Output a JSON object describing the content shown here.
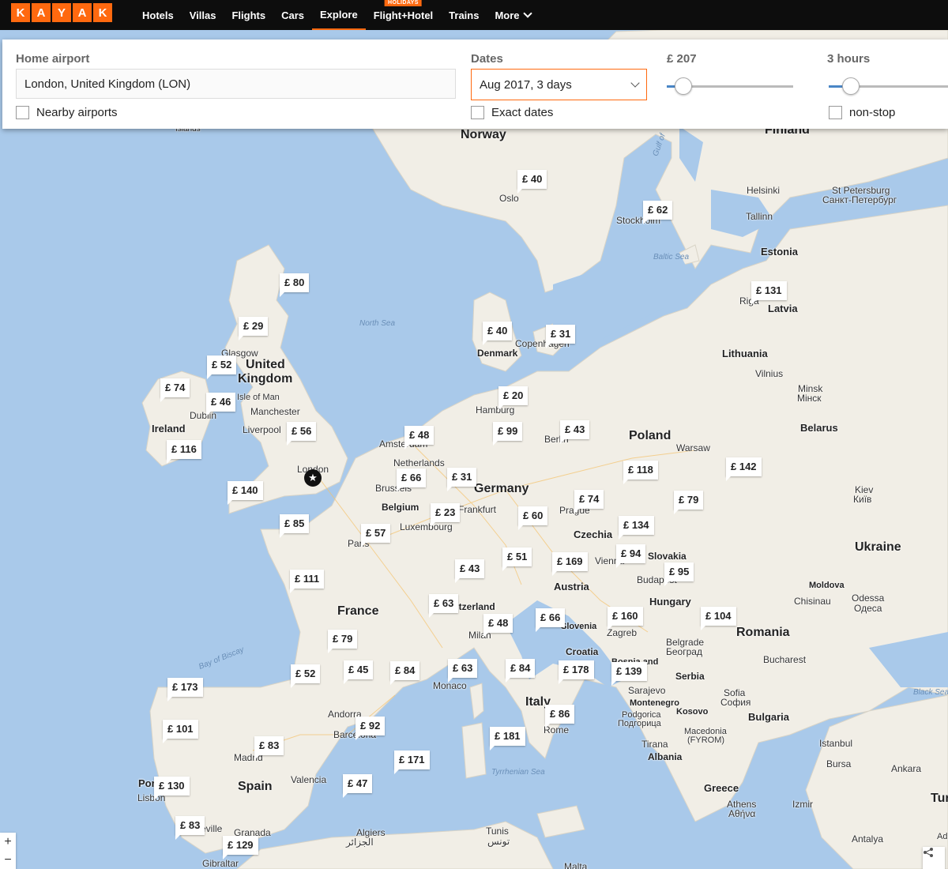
{
  "logo": [
    "K",
    "A",
    "Y",
    "A",
    "K"
  ],
  "nav": {
    "items": [
      {
        "label": "Hotels",
        "active": false
      },
      {
        "label": "Villas",
        "active": false
      },
      {
        "label": "Flights",
        "active": false
      },
      {
        "label": "Cars",
        "active": false
      },
      {
        "label": "Explore",
        "active": true
      },
      {
        "label": "Flight+Hotel",
        "active": false,
        "badge": "HOLIDAYS"
      },
      {
        "label": "Trains",
        "active": false
      },
      {
        "label": "More",
        "active": false,
        "icon": "chevron-down-icon"
      }
    ]
  },
  "filters": {
    "home_airport": {
      "label": "Home airport",
      "value": "London, United Kingdom (LON)"
    },
    "nearby": {
      "label": "Nearby airports",
      "checked": false
    },
    "dates": {
      "label": "Dates",
      "value": "Aug 2017, 3 days"
    },
    "exact": {
      "label": "Exact dates",
      "checked": false
    },
    "price": {
      "label": "£ 207"
    },
    "duration": {
      "label": "3 hours"
    },
    "nonstop": {
      "label": "non-stop",
      "checked": false
    }
  },
  "map": {
    "places": [
      {
        "name": "Norway",
        "kind": "country"
      },
      {
        "name": "Finland",
        "kind": "country"
      },
      {
        "name": "United",
        "kind": "country"
      },
      {
        "name": "Kingdom",
        "kind": "country"
      },
      {
        "name": "Ireland",
        "kind": "country-s"
      },
      {
        "name": "Estonia",
        "kind": "country-s"
      },
      {
        "name": "Latvia",
        "kind": "country-s"
      },
      {
        "name": "Lithuania",
        "kind": "country-s"
      },
      {
        "name": "Belarus",
        "kind": "country-s"
      },
      {
        "name": "Poland",
        "kind": "country"
      },
      {
        "name": "Germany",
        "kind": "country"
      },
      {
        "name": "Ukraine",
        "kind": "country"
      },
      {
        "name": "France",
        "kind": "country"
      },
      {
        "name": "Romania",
        "kind": "country"
      },
      {
        "name": "Spain",
        "kind": "country"
      },
      {
        "name": "Italy",
        "kind": "country"
      },
      {
        "name": "Greece",
        "kind": "country-s"
      },
      {
        "name": "Czechia",
        "kind": "country-s"
      },
      {
        "name": "Austria",
        "kind": "country-s"
      },
      {
        "name": "Hungary",
        "kind": "country-s"
      },
      {
        "name": "Denmark",
        "kind": "country-s"
      },
      {
        "name": "Belgium",
        "kind": "country-s"
      },
      {
        "name": "Serbia",
        "kind": "country-s"
      },
      {
        "name": "Bulgaria",
        "kind": "country-s"
      },
      {
        "name": "Croatia",
        "kind": "country-s"
      },
      {
        "name": "Albania",
        "kind": "country-s"
      },
      {
        "name": "Moldova",
        "kind": "country-s"
      },
      {
        "name": "Kosovo",
        "kind": "country-s"
      },
      {
        "name": "Montenegro",
        "kind": "country-s"
      },
      {
        "name": "North Sea",
        "kind": "sea"
      },
      {
        "name": "Baltic Sea",
        "kind": "sea"
      },
      {
        "name": "Bay of Biscay",
        "kind": "sea"
      },
      {
        "name": "Tyrrhenian Sea",
        "kind": "sea"
      },
      {
        "name": "Black Sea",
        "kind": "sea"
      },
      {
        "name": "Oslo",
        "kind": "city"
      },
      {
        "name": "Helsinki",
        "kind": "city"
      },
      {
        "name": "St Petersburg",
        "kind": "city"
      },
      {
        "name": "Санкт-Петербург",
        "kind": "city"
      },
      {
        "name": "Tallinn",
        "kind": "city"
      },
      {
        "name": "Glasgow",
        "kind": "city"
      },
      {
        "name": "Manchester",
        "kind": "city"
      },
      {
        "name": "Liverpool",
        "kind": "city"
      },
      {
        "name": "Dublin",
        "kind": "city"
      },
      {
        "name": "London",
        "kind": "city"
      },
      {
        "name": "Hamburg",
        "kind": "city"
      },
      {
        "name": "Amsterdam",
        "kind": "city"
      },
      {
        "name": "Netherlands",
        "kind": "country-s"
      },
      {
        "name": "Brussels",
        "kind": "city"
      },
      {
        "name": "Luxembourg",
        "kind": "city"
      },
      {
        "name": "Paris",
        "kind": "city"
      },
      {
        "name": "Warsaw",
        "kind": "city"
      },
      {
        "name": "Kiev",
        "kind": "city"
      },
      {
        "name": "Київ",
        "kind": "city"
      },
      {
        "name": "Minsk",
        "kind": "city"
      },
      {
        "name": "Мінск",
        "kind": "city"
      },
      {
        "name": "Vilnius",
        "kind": "city"
      },
      {
        "name": "Riga",
        "kind": "city"
      },
      {
        "name": "Prague",
        "kind": "city"
      },
      {
        "name": "Vienna",
        "kind": "city"
      },
      {
        "name": "Budapest",
        "kind": "city"
      },
      {
        "name": "Zagreb",
        "kind": "city"
      },
      {
        "name": "Belgrade",
        "kind": "city"
      },
      {
        "name": "Београд",
        "kind": "city"
      },
      {
        "name": "Bucharest",
        "kind": "city"
      },
      {
        "name": "Chisinau",
        "kind": "city"
      },
      {
        "name": "Odessa",
        "kind": "city"
      },
      {
        "name": "Одеса",
        "kind": "city"
      },
      {
        "name": "Sofia",
        "kind": "city"
      },
      {
        "name": "София",
        "kind": "city"
      },
      {
        "name": "Istanbul",
        "kind": "city"
      },
      {
        "name": "Bursa",
        "kind": "city"
      },
      {
        "name": "Ankara",
        "kind": "city"
      },
      {
        "name": "Izmir",
        "kind": "city"
      },
      {
        "name": "Athens",
        "kind": "city"
      },
      {
        "name": "Αθήνα",
        "kind": "city"
      },
      {
        "name": "Antalya",
        "kind": "city"
      },
      {
        "name": "Macedonia",
        "kind": "city"
      },
      {
        "name": "(FYROM)",
        "kind": "city"
      },
      {
        "name": "Tirana",
        "kind": "city"
      },
      {
        "name": "Sarajevo",
        "kind": "city"
      },
      {
        "name": "Podgorica",
        "kind": "city"
      },
      {
        "name": "Подгорица",
        "kind": "city"
      },
      {
        "name": "Rome",
        "kind": "city"
      },
      {
        "name": "Monaco",
        "kind": "city"
      },
      {
        "name": "Andorra",
        "kind": "city"
      },
      {
        "name": "Barcelona",
        "kind": "city"
      },
      {
        "name": "Madrid",
        "kind": "city"
      },
      {
        "name": "Valencia",
        "kind": "city"
      },
      {
        "name": "Lisbon",
        "kind": "city"
      },
      {
        "name": "Seville",
        "kind": "city"
      },
      {
        "name": "Granada",
        "kind": "city"
      },
      {
        "name": "Gibraltar",
        "kind": "city"
      },
      {
        "name": "Algiers",
        "kind": "city"
      },
      {
        "name": "الجزائر",
        "kind": "city"
      },
      {
        "name": "Tunis",
        "kind": "city"
      },
      {
        "name": "تونس",
        "kind": "city"
      },
      {
        "name": "Malta",
        "kind": "city"
      },
      {
        "name": "Copenhagen",
        "kind": "city"
      },
      {
        "name": "Stockholm",
        "kind": "city"
      },
      {
        "name": "Berlin",
        "kind": "city"
      },
      {
        "name": "Frankfurt",
        "kind": "city"
      },
      {
        "name": "Milan",
        "kind": "city"
      },
      {
        "name": "Switzerland",
        "kind": "country-s"
      },
      {
        "name": "Slovakia",
        "kind": "country-s"
      },
      {
        "name": "Slovenia",
        "kind": "country-s"
      },
      {
        "name": "Isle of Man",
        "kind": "city"
      },
      {
        "name": "Islands",
        "kind": "city"
      },
      {
        "name": "Gulf of",
        "kind": "sea"
      },
      {
        "name": "Portugal",
        "kind": "country-s"
      },
      {
        "name": "Bosnia and",
        "kind": "country-s"
      },
      {
        "name": "Turkey",
        "kind": "country"
      },
      {
        "name": "Adana",
        "kind": "city"
      }
    ],
    "prices": [
      {
        "label": "£ 40"
      },
      {
        "label": "£ 62"
      },
      {
        "label": "£ 80"
      },
      {
        "label": "£ 29"
      },
      {
        "label": "£ 131"
      },
      {
        "label": "£ 52"
      },
      {
        "label": "£ 74"
      },
      {
        "label": "£ 46"
      },
      {
        "label": "£ 40"
      },
      {
        "label": "£ 31"
      },
      {
        "label": "£ 20"
      },
      {
        "label": "£ 116"
      },
      {
        "label": "£ 56"
      },
      {
        "label": "£ 48"
      },
      {
        "label": "£ 99"
      },
      {
        "label": "£ 43"
      },
      {
        "label": "£ 140"
      },
      {
        "label": "£ 66"
      },
      {
        "label": "£ 31"
      },
      {
        "label": "£ 118"
      },
      {
        "label": "£ 142"
      },
      {
        "label": "£ 74"
      },
      {
        "label": "£ 79"
      },
      {
        "label": "£ 23"
      },
      {
        "label": "£ 85"
      },
      {
        "label": "£ 60"
      },
      {
        "label": "£ 134"
      },
      {
        "label": "£ 57"
      },
      {
        "label": "£ 94"
      },
      {
        "label": "£ 51"
      },
      {
        "label": "£ 169"
      },
      {
        "label": "£ 95"
      },
      {
        "label": "£ 111"
      },
      {
        "label": "£ 43"
      },
      {
        "label": "£ 63"
      },
      {
        "label": "£ 66"
      },
      {
        "label": "£ 160"
      },
      {
        "label": "£ 104"
      },
      {
        "label": "£ 48"
      },
      {
        "label": "£ 79"
      },
      {
        "label": "£ 52"
      },
      {
        "label": "£ 45"
      },
      {
        "label": "£ 84"
      },
      {
        "label": "£ 63"
      },
      {
        "label": "£ 84"
      },
      {
        "label": "£ 178"
      },
      {
        "label": "£ 139"
      },
      {
        "label": "£ 173"
      },
      {
        "label": "£ 86"
      },
      {
        "label": "£ 92"
      },
      {
        "label": "£ 101"
      },
      {
        "label": "£ 181"
      },
      {
        "label": "£ 83"
      },
      {
        "label": "£ 171"
      },
      {
        "label": "£ 130"
      },
      {
        "label": "£ 47"
      },
      {
        "label": "£ 83"
      },
      {
        "label": "£ 129"
      }
    ],
    "home_marker": "★",
    "zoom_in": "+",
    "zoom_out": "−"
  },
  "colors": {
    "accent": "#ff690f",
    "water": "#a9c9ea",
    "land": "#f1eee6"
  }
}
